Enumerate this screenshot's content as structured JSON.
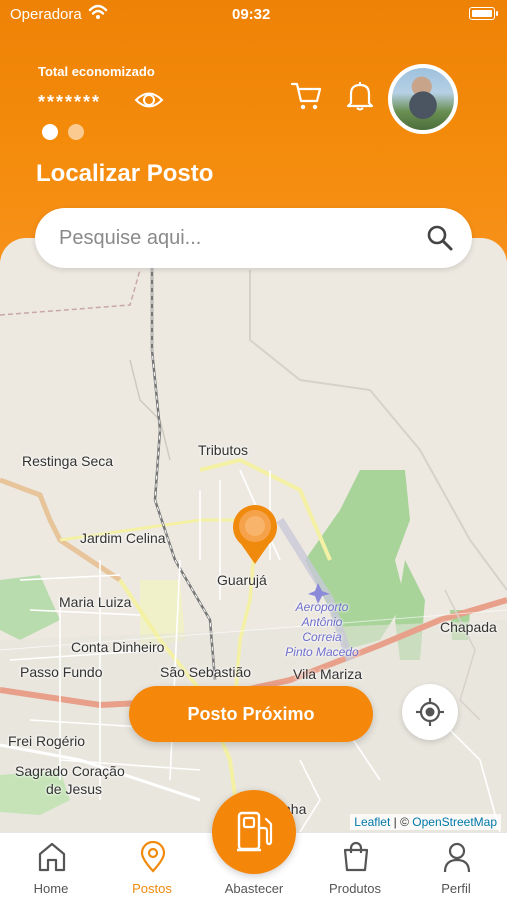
{
  "status_bar": {
    "carrier": "Operadora",
    "time": "09:32"
  },
  "header": {
    "total_label": "Total economizado",
    "total_value": "*******",
    "title": "Localizar Posto",
    "carousel_pages": 2,
    "carousel_active": 1
  },
  "search": {
    "placeholder": "Pesquise aqui..."
  },
  "map": {
    "labels": {
      "restinga": "Restinga Seca",
      "tributos": "Tributos",
      "celina": "Jardim Celina",
      "guaruja": "Guarujá",
      "maria_luiza": "Maria Luiza",
      "conta_dinheiro": "Conta Dinheiro",
      "passo_fundo": "Passo Fundo",
      "sao_sebastiao": "São Sebastião",
      "vila_mariza": "Vila Mariza",
      "chapada": "Chapada",
      "frei": "Frei Rogério",
      "sagrado1": "Sagrado Coração",
      "sagrado2": "de Jesus",
      "airport1": "Aeroporto",
      "airport2": "Antônio",
      "airport3": "Correia",
      "airport4": "Pinto Macedo",
      "partial": "nha"
    },
    "attribution_leaflet": "Leaflet",
    "attribution_sep": " | © ",
    "attribution_osm": "OpenStreetMap"
  },
  "actions": {
    "nearest_label": "Posto Próximo"
  },
  "tabs": {
    "home": "Home",
    "postos": "Postos",
    "abastecer": "Abastecer",
    "produtos": "Produtos",
    "perfil": "Perfil"
  },
  "colors": {
    "accent": "#f5870a",
    "accent_dark": "#ee8206",
    "tab_inactive": "#555555"
  },
  "icons": [
    "wifi-icon",
    "battery-icon",
    "eye-icon",
    "cart-icon",
    "bell-icon",
    "search-icon",
    "map-pin-icon",
    "locate-icon",
    "home-icon",
    "location-icon",
    "fuel-pump-icon",
    "shopping-bag-icon",
    "user-icon"
  ]
}
